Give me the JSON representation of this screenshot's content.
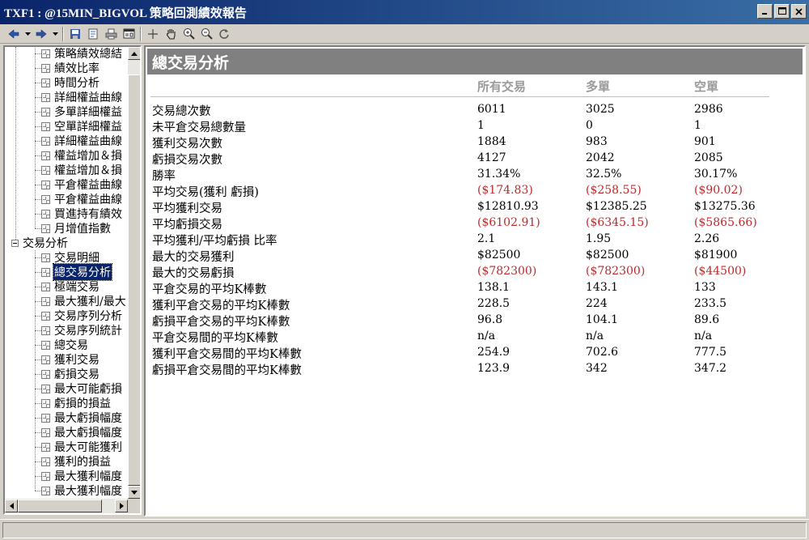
{
  "window": {
    "title": "TXF1 : @15MIN_BIGVOL 策略回測績效報告"
  },
  "tree": {
    "items": [
      {
        "label": "策略績效總結",
        "level": 2
      },
      {
        "label": "績效比率",
        "level": 2
      },
      {
        "label": "時間分析",
        "level": 2
      },
      {
        "label": "詳細權益曲線",
        "level": 2
      },
      {
        "label": "多單詳細權益",
        "level": 2
      },
      {
        "label": "空單詳細權益",
        "level": 2
      },
      {
        "label": "詳細權益曲線",
        "level": 2
      },
      {
        "label": "權益增加＆損",
        "level": 2
      },
      {
        "label": "權益增加＆損",
        "level": 2
      },
      {
        "label": "平倉權益曲線",
        "level": 2
      },
      {
        "label": "平倉權益曲線",
        "level": 2
      },
      {
        "label": "買進持有績效",
        "level": 2
      },
      {
        "label": "月增值指數",
        "level": 2
      },
      {
        "label": "交易分析",
        "level": 1
      },
      {
        "label": "交易明細",
        "level": 2
      },
      {
        "label": "總交易分析",
        "level": 2,
        "selected": true
      },
      {
        "label": "極端交易",
        "level": 2
      },
      {
        "label": "最大獲利/最大",
        "level": 2
      },
      {
        "label": "交易序列分析",
        "level": 2
      },
      {
        "label": "交易序列統計",
        "level": 2
      },
      {
        "label": "總交易",
        "level": 2
      },
      {
        "label": "獲利交易",
        "level": 2
      },
      {
        "label": "虧損交易",
        "level": 2
      },
      {
        "label": "最大可能虧損",
        "level": 2
      },
      {
        "label": "虧損的損益",
        "level": 2
      },
      {
        "label": "最大虧損幅度",
        "level": 2
      },
      {
        "label": "最大虧損幅度",
        "level": 2
      },
      {
        "label": "最大可能獲利",
        "level": 2
      },
      {
        "label": "獲利的損益",
        "level": 2
      },
      {
        "label": "最大獲利幅度",
        "level": 2
      },
      {
        "label": "最大獲利幅度",
        "level": 2
      }
    ]
  },
  "report": {
    "section_title": "總交易分析",
    "columns": [
      "所有交易",
      "多單",
      "空單"
    ],
    "rows": [
      {
        "label": "交易總次數",
        "values": [
          "6011",
          "3025",
          "2986"
        ]
      },
      {
        "label": "未平倉交易總數量",
        "values": [
          "1",
          "0",
          "1"
        ]
      },
      {
        "label": "獲利交易次數",
        "values": [
          "1884",
          "983",
          "901"
        ]
      },
      {
        "label": "虧損交易次數",
        "values": [
          "4127",
          "2042",
          "2085"
        ]
      },
      {
        "label": "勝率",
        "values": [
          "31.34%",
          "32.5%",
          "30.17%"
        ]
      },
      {
        "label": "平均交易(獲利 虧損)",
        "values": [
          "($174.83)",
          "($258.55)",
          "($90.02)"
        ]
      },
      {
        "label": "平均獲利交易",
        "values": [
          "$12810.93",
          "$12385.25",
          "$13275.36"
        ]
      },
      {
        "label": "平均虧損交易",
        "values": [
          "($6102.91)",
          "($6345.15)",
          "($5865.66)"
        ]
      },
      {
        "label": "平均獲利/平均虧損 比率",
        "values": [
          "2.1",
          "1.95",
          "2.26"
        ]
      },
      {
        "label": "最大的交易獲利",
        "values": [
          "$82500",
          "$82500",
          "$81900"
        ]
      },
      {
        "label": "最大的交易虧損",
        "values": [
          "($782300)",
          "($782300)",
          "($44500)"
        ]
      },
      {
        "label": "平倉交易的平均K棒數",
        "values": [
          "138.1",
          "143.1",
          "133"
        ]
      },
      {
        "label": "獲利平倉交易的平均K棒數",
        "values": [
          "228.5",
          "224",
          "233.5"
        ]
      },
      {
        "label": "虧損平倉交易的平均K棒數",
        "values": [
          "96.8",
          "104.1",
          "89.6"
        ]
      },
      {
        "label": "平倉交易間的平均K棒數",
        "values": [
          "n/a",
          "n/a",
          "n/a"
        ]
      },
      {
        "label": "獲利平倉交易間的平均K棒數",
        "values": [
          "254.9",
          "702.6",
          "777.5"
        ]
      },
      {
        "label": "虧損平倉交易間的平均K棒數",
        "values": [
          "123.9",
          "342",
          "347.2"
        ]
      }
    ]
  },
  "colors": {
    "negative": "#c0282a",
    "header_bg": "#808080",
    "column_header": "#9a9a9a",
    "title_bar": "#0a246a"
  },
  "icons": {
    "toolbar": [
      "back-arrow-icon",
      "dropdown-icon",
      "forward-arrow-icon",
      "dropdown-icon",
      "save-icon",
      "preview-icon",
      "print-icon",
      "layout-icon",
      "crosshair-icon",
      "hand-icon",
      "zoom-in-icon",
      "zoom-out-icon",
      "refresh-icon"
    ]
  }
}
